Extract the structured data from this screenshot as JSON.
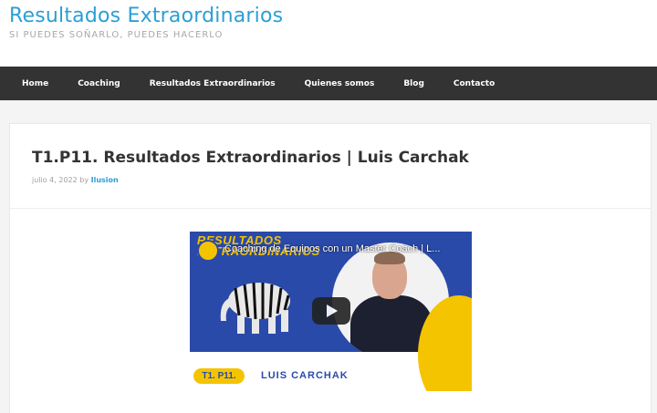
{
  "site": {
    "title": "Resultados Extraordinarios",
    "tagline": "SI PUEDES SOÑARLO, PUEDES HACERLO"
  },
  "nav": {
    "items": [
      {
        "label": "Home"
      },
      {
        "label": "Coaching"
      },
      {
        "label": "Resultados Extraordinarios"
      },
      {
        "label": "Quienes somos"
      },
      {
        "label": "Blog"
      },
      {
        "label": "Contacto"
      }
    ]
  },
  "post": {
    "title": "T1.P11. Resultados Extraordinarios | Luis Carchak",
    "date": "julio 4, 2022",
    "by": "by",
    "author": "Ilusion"
  },
  "video": {
    "title": "Coaching de Equipos con un Master Coach | L...",
    "brand_line1": "RESULTADOS",
    "brand_line2": "EXTRAORDINARIOS",
    "episode": "T1. P11.",
    "name": "LUIS CARCHAK"
  },
  "colors": {
    "accent": "#2a9fd6",
    "nav_bg": "#333333",
    "video_blue": "#2a4aaa",
    "video_yellow": "#f5c400"
  }
}
